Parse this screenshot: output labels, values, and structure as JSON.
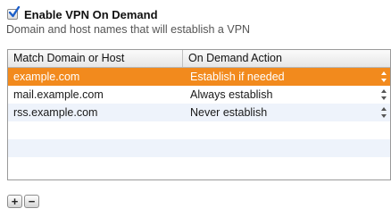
{
  "vpn_on_demand": {
    "enabled_label": "Enable VPN On Demand",
    "enabled": true,
    "description": "Domain and host names that will establish a VPN"
  },
  "table": {
    "columns": [
      "Match Domain or Host",
      "On Demand Action"
    ],
    "rows": [
      {
        "host": "example.com",
        "action": "Establish if needed",
        "selected": true
      },
      {
        "host": "mail.example.com",
        "action": "Always establish",
        "selected": false
      },
      {
        "host": "rss.example.com",
        "action": "Never establish",
        "selected": false
      }
    ]
  },
  "buttons": {
    "add_label": "+",
    "remove_label": "−"
  },
  "colors": {
    "selection": "#f28a1d",
    "alt_row": "#eef3fb"
  }
}
